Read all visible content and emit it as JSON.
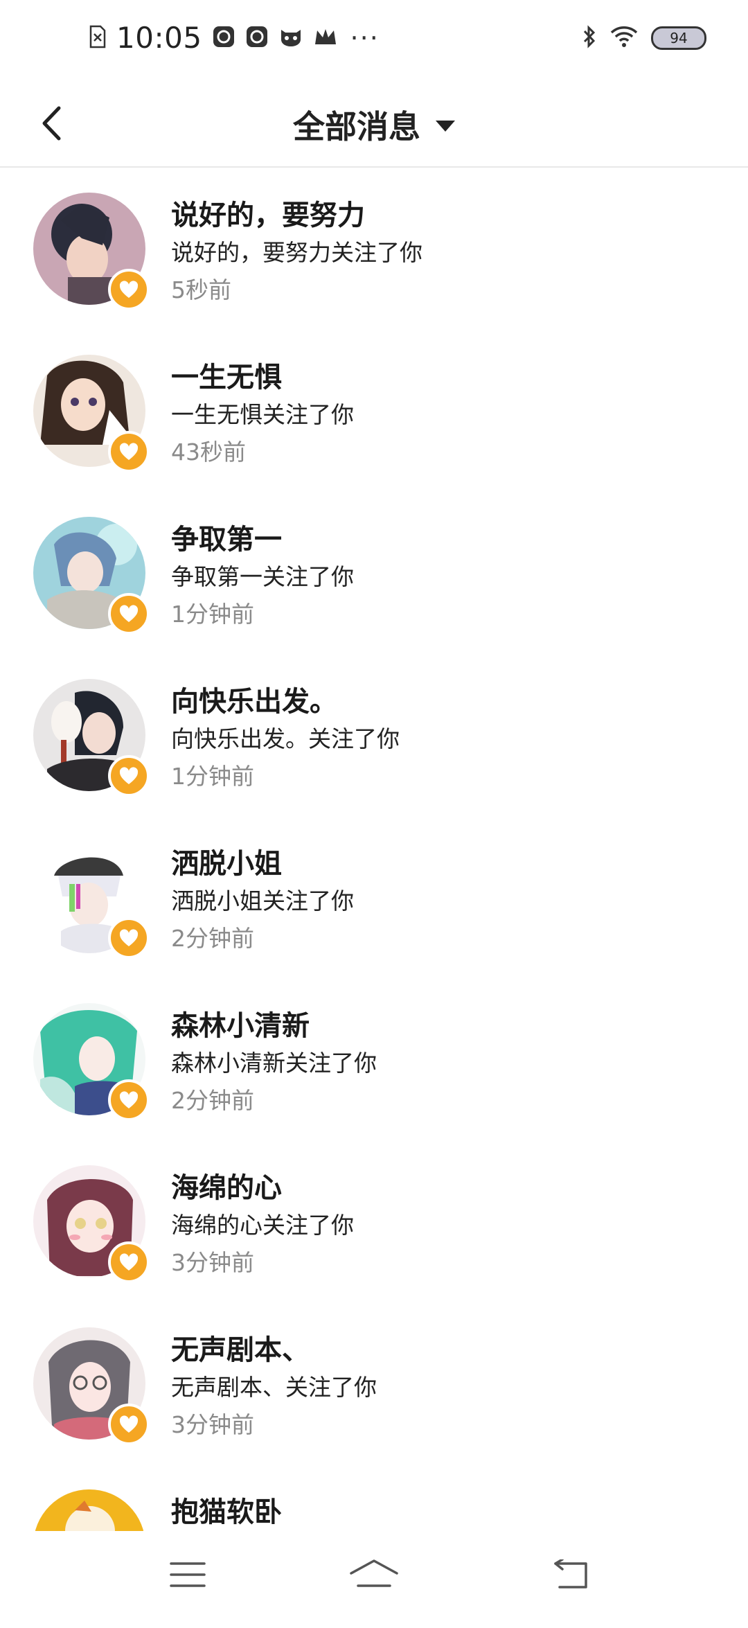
{
  "status_bar": {
    "time": "10:05",
    "battery": "94",
    "icons": [
      "sim-off-icon",
      "app-icon-1",
      "app-icon-2",
      "mask-icon",
      "crown-icon",
      "more-dots-icon",
      "bluetooth-icon",
      "wifi-icon",
      "battery-icon"
    ]
  },
  "header": {
    "back_icon": "chevron-left-icon",
    "title": "全部消息",
    "dropdown_icon": "caret-down-icon"
  },
  "badge_icon": "heart-icon",
  "colors": {
    "badge": "#f5a623",
    "divider": "#e8e8e8",
    "secondary_text": "#8a8a8a"
  },
  "messages": [
    {
      "name": "说好的，要努力",
      "desc": "说好的，要努力关注了你",
      "time": "5秒前"
    },
    {
      "name": "一生无惧",
      "desc": "一生无惧关注了你",
      "time": "43秒前"
    },
    {
      "name": "争取第一",
      "desc": "争取第一关注了你",
      "time": "1分钟前"
    },
    {
      "name": "向快乐出发。",
      "desc": "向快乐出发。关注了你",
      "time": "1分钟前"
    },
    {
      "name": "洒脱小姐",
      "desc": "洒脱小姐关注了你",
      "time": "2分钟前"
    },
    {
      "name": "森林小清新",
      "desc": "森林小清新关注了你",
      "time": "2分钟前"
    },
    {
      "name": "海绵的心",
      "desc": "海绵的心关注了你",
      "time": "3分钟前"
    },
    {
      "name": "无声剧本、",
      "desc": "无声剧本、关注了你",
      "time": "3分钟前"
    },
    {
      "name": "抱猫软卧"
    }
  ],
  "nav": {
    "icons": [
      "menu-icon",
      "home-icon",
      "back-icon"
    ]
  }
}
